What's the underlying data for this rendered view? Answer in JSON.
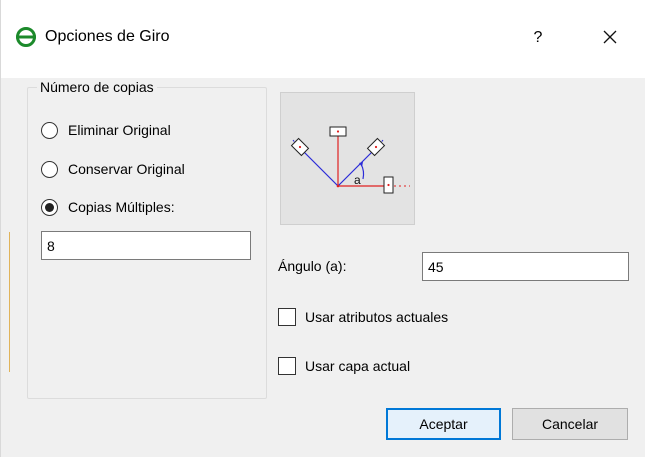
{
  "window": {
    "title": "Opciones de Giro",
    "help_label": "?",
    "icon": "app-logo-icon",
    "close_icon": "close-icon"
  },
  "copies_group": {
    "title": "Número de copias",
    "options": [
      {
        "label": "Eliminar Original",
        "checked": false
      },
      {
        "label": "Conservar Original",
        "checked": false
      },
      {
        "label": "Copias Múltiples:",
        "checked": true
      }
    ],
    "count_value": "8"
  },
  "preview": {
    "angle_marker": "a"
  },
  "angle": {
    "label": "Ángulo (a):",
    "value": "45"
  },
  "options": {
    "use_current_attributes": {
      "label": "Usar atributos actuales",
      "checked": false
    },
    "use_current_layer": {
      "label": "Usar capa actual",
      "checked": false
    }
  },
  "buttons": {
    "accept": "Aceptar",
    "cancel": "Cancelar"
  },
  "colors": {
    "accent": "#0078d7",
    "preview_red": "#e02020",
    "preview_blue": "#2b2bd8"
  }
}
